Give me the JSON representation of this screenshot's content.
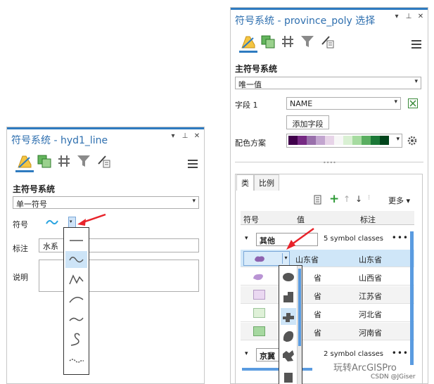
{
  "left_pane": {
    "title": "符号系统 - hyd1_line",
    "controls": [
      "▾",
      "⊥",
      "✕"
    ],
    "section_title": "主符号系统",
    "renderer": "单一符号",
    "symbol_label": "符号",
    "label_label": "标注",
    "label_value": "水系",
    "desc_label": "说明",
    "symbol_menu_items": [
      "straight-line-icon",
      "wave-line-icon",
      "zigzag-line-icon",
      "arc-line-icon",
      "tilde-line-icon",
      "loop-line-icon",
      "dashed-wave-icon"
    ],
    "selected_menu_index": 1
  },
  "right_pane": {
    "title": "符号系统 - province_poly 选择",
    "controls": [
      "▾",
      "⊥",
      "✕"
    ],
    "section_title": "主符号系统",
    "renderer": "唯一值",
    "field_label": "字段 1",
    "field_value": "NAME",
    "add_field": "添加字段",
    "color_scheme_label": "配色方案",
    "palette": [
      "#40004b",
      "#762a83",
      "#9970ab",
      "#c2a5cf",
      "#e7d4e8",
      "#f7f7f7",
      "#d9f0d3",
      "#a6dba0",
      "#5aae61",
      "#1b7837",
      "#00441b"
    ],
    "tabs": [
      "类",
      "比例"
    ],
    "more": "更多",
    "col_symbol": "符号",
    "col_value": "值",
    "col_label": "标注",
    "group1": {
      "name": "其他",
      "count": "5 symbol classes",
      "more": "•••"
    },
    "rows": [
      {
        "value": "山东省",
        "label": "山东省",
        "color": "#8e63b0"
      },
      {
        "value": "省",
        "label": "山西省",
        "color": "#b994d4"
      },
      {
        "value": "省",
        "label": "江苏省",
        "color": "#ead8f1"
      },
      {
        "value": "省",
        "label": "河北省",
        "color": "#dff1d8"
      },
      {
        "value": "省",
        "label": "河南省",
        "color": "#a6d8a0"
      }
    ],
    "group2": {
      "name": "京冀",
      "count": "2 symbol classes",
      "more": "•••"
    },
    "symbol_menu_items": [
      "ellipse-icon",
      "step-shape-icon",
      "puzzle-shape-icon",
      "blob-shape-icon",
      "region-shape-icon",
      "square-shape-icon"
    ],
    "selected_menu_index": 2
  },
  "watermark": "玩转ArcGISPro",
  "credit": "CSDN @JGiser",
  "colors": {
    "accent": "#2e7bc0",
    "arrow": "#e8232a",
    "selected": "#cfe6f8"
  }
}
